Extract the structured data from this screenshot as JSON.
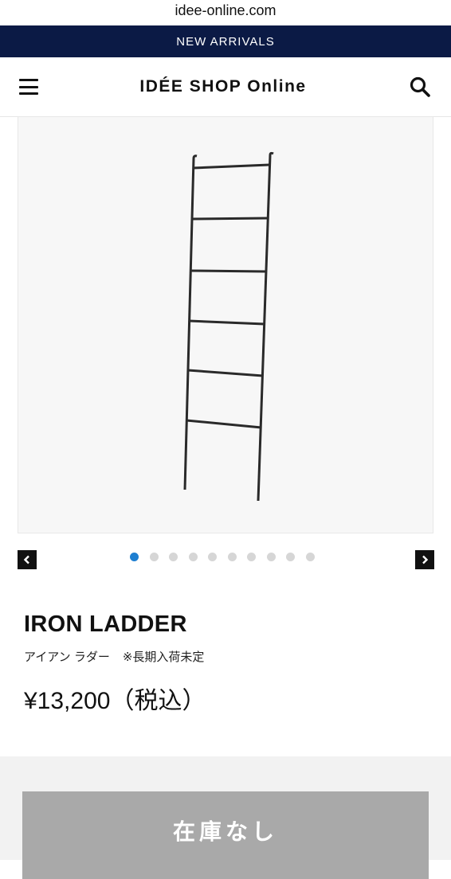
{
  "browser": {
    "url": "idee-online.com"
  },
  "promo": {
    "label": "NEW ARRIVALS"
  },
  "header": {
    "brand": "IDÉE SHOP Online"
  },
  "icons": {
    "menu": "hamburger-menu-icon",
    "search": "search-icon",
    "prev": "chevron-left-icon",
    "next": "chevron-right-icon"
  },
  "gallery": {
    "total_images": 10,
    "active_index": 0
  },
  "product": {
    "name": "IRON LADDER",
    "name_ja": "アイアン ラダー",
    "stock_note": "※長期入荷未定",
    "price": "¥13,200（税込）"
  },
  "cta": {
    "label": "在庫なし",
    "enabled": false
  },
  "colors": {
    "promo_bg": "#0b1a45",
    "active_dot": "#1e7fd1",
    "disabled_button": "#a9a9a9"
  }
}
